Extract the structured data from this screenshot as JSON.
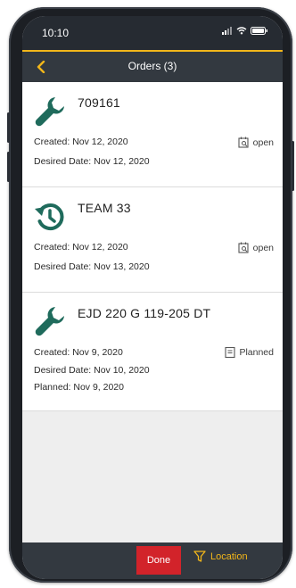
{
  "status_bar": {
    "time": "10:10"
  },
  "nav": {
    "title": "Orders (3)"
  },
  "orders": [
    {
      "icon": "wrench-icon",
      "title": "709161",
      "created": "Created: Nov 12, 2020",
      "desired": "Desired Date: Nov 12, 2020",
      "status": "open"
    },
    {
      "icon": "history-icon",
      "title": "TEAM 33",
      "created": "Created: Nov 12, 2020",
      "desired": "Desired Date: Nov 13, 2020",
      "status": "open"
    },
    {
      "icon": "wrench-icon",
      "title": "EJD 220 G 119-205 DT",
      "created": "Created: Nov 9, 2020",
      "desired": "Desired Date: Nov 10, 2020",
      "planned": "Planned: Nov 9, 2020",
      "status": "Planned"
    }
  ],
  "footer": {
    "done_label": "Done",
    "location_label": "Location"
  },
  "colors": {
    "accent": "#f2b61a",
    "teal": "#1f6b5c",
    "dark": "#333940",
    "done_red": "#d2232a"
  }
}
